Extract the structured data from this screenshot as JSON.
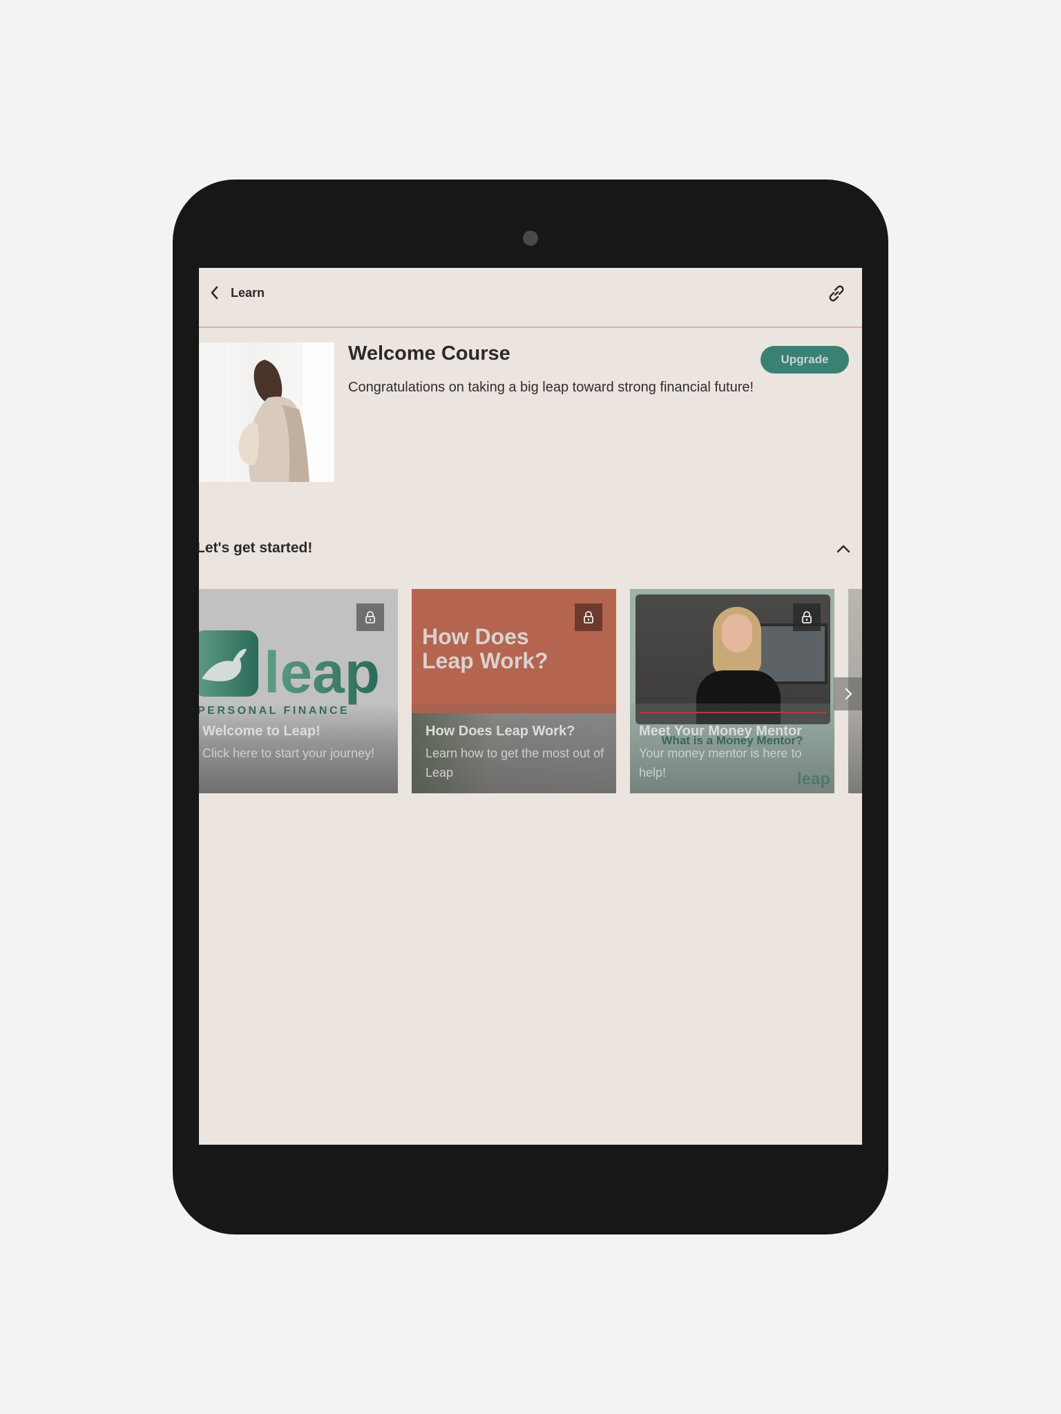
{
  "topbar": {
    "back_label": "Learn",
    "back_icon": "chevron-left-icon",
    "share_icon": "link-icon"
  },
  "course": {
    "title": "Welcome Course",
    "description": "Congratulations on taking a big leap toward strong financial future!",
    "upgrade_label": "Upgrade",
    "image_alt": "pregnant woman by window"
  },
  "section": {
    "title": "Let's get started!",
    "toggle_icon": "chevron-up-icon"
  },
  "cards": [
    {
      "thumbnail_text": "leap",
      "thumbnail_subtext": "PERSONAL FINANCE",
      "title": "Welcome to Leap!",
      "description": "Click here to start your journey!",
      "locked": true
    },
    {
      "thumbnail_text": "How Does Leap Work?",
      "title": "How Does Leap Work?",
      "description": " Learn how to get the most out of Leap",
      "locked": true
    },
    {
      "thumbnail_text": "What is a Money Mentor?",
      "title": "Meet Your Money Mentor",
      "description": "Your money mentor is here to help!",
      "watermark": "leap",
      "locked": true
    }
  ],
  "carousel": {
    "next_icon": "chevron-right-icon"
  },
  "colors": {
    "accent": "#3a8173",
    "divider": "#e5ab9a",
    "screen_bg": "#ece4df",
    "bezel": "#171717"
  }
}
